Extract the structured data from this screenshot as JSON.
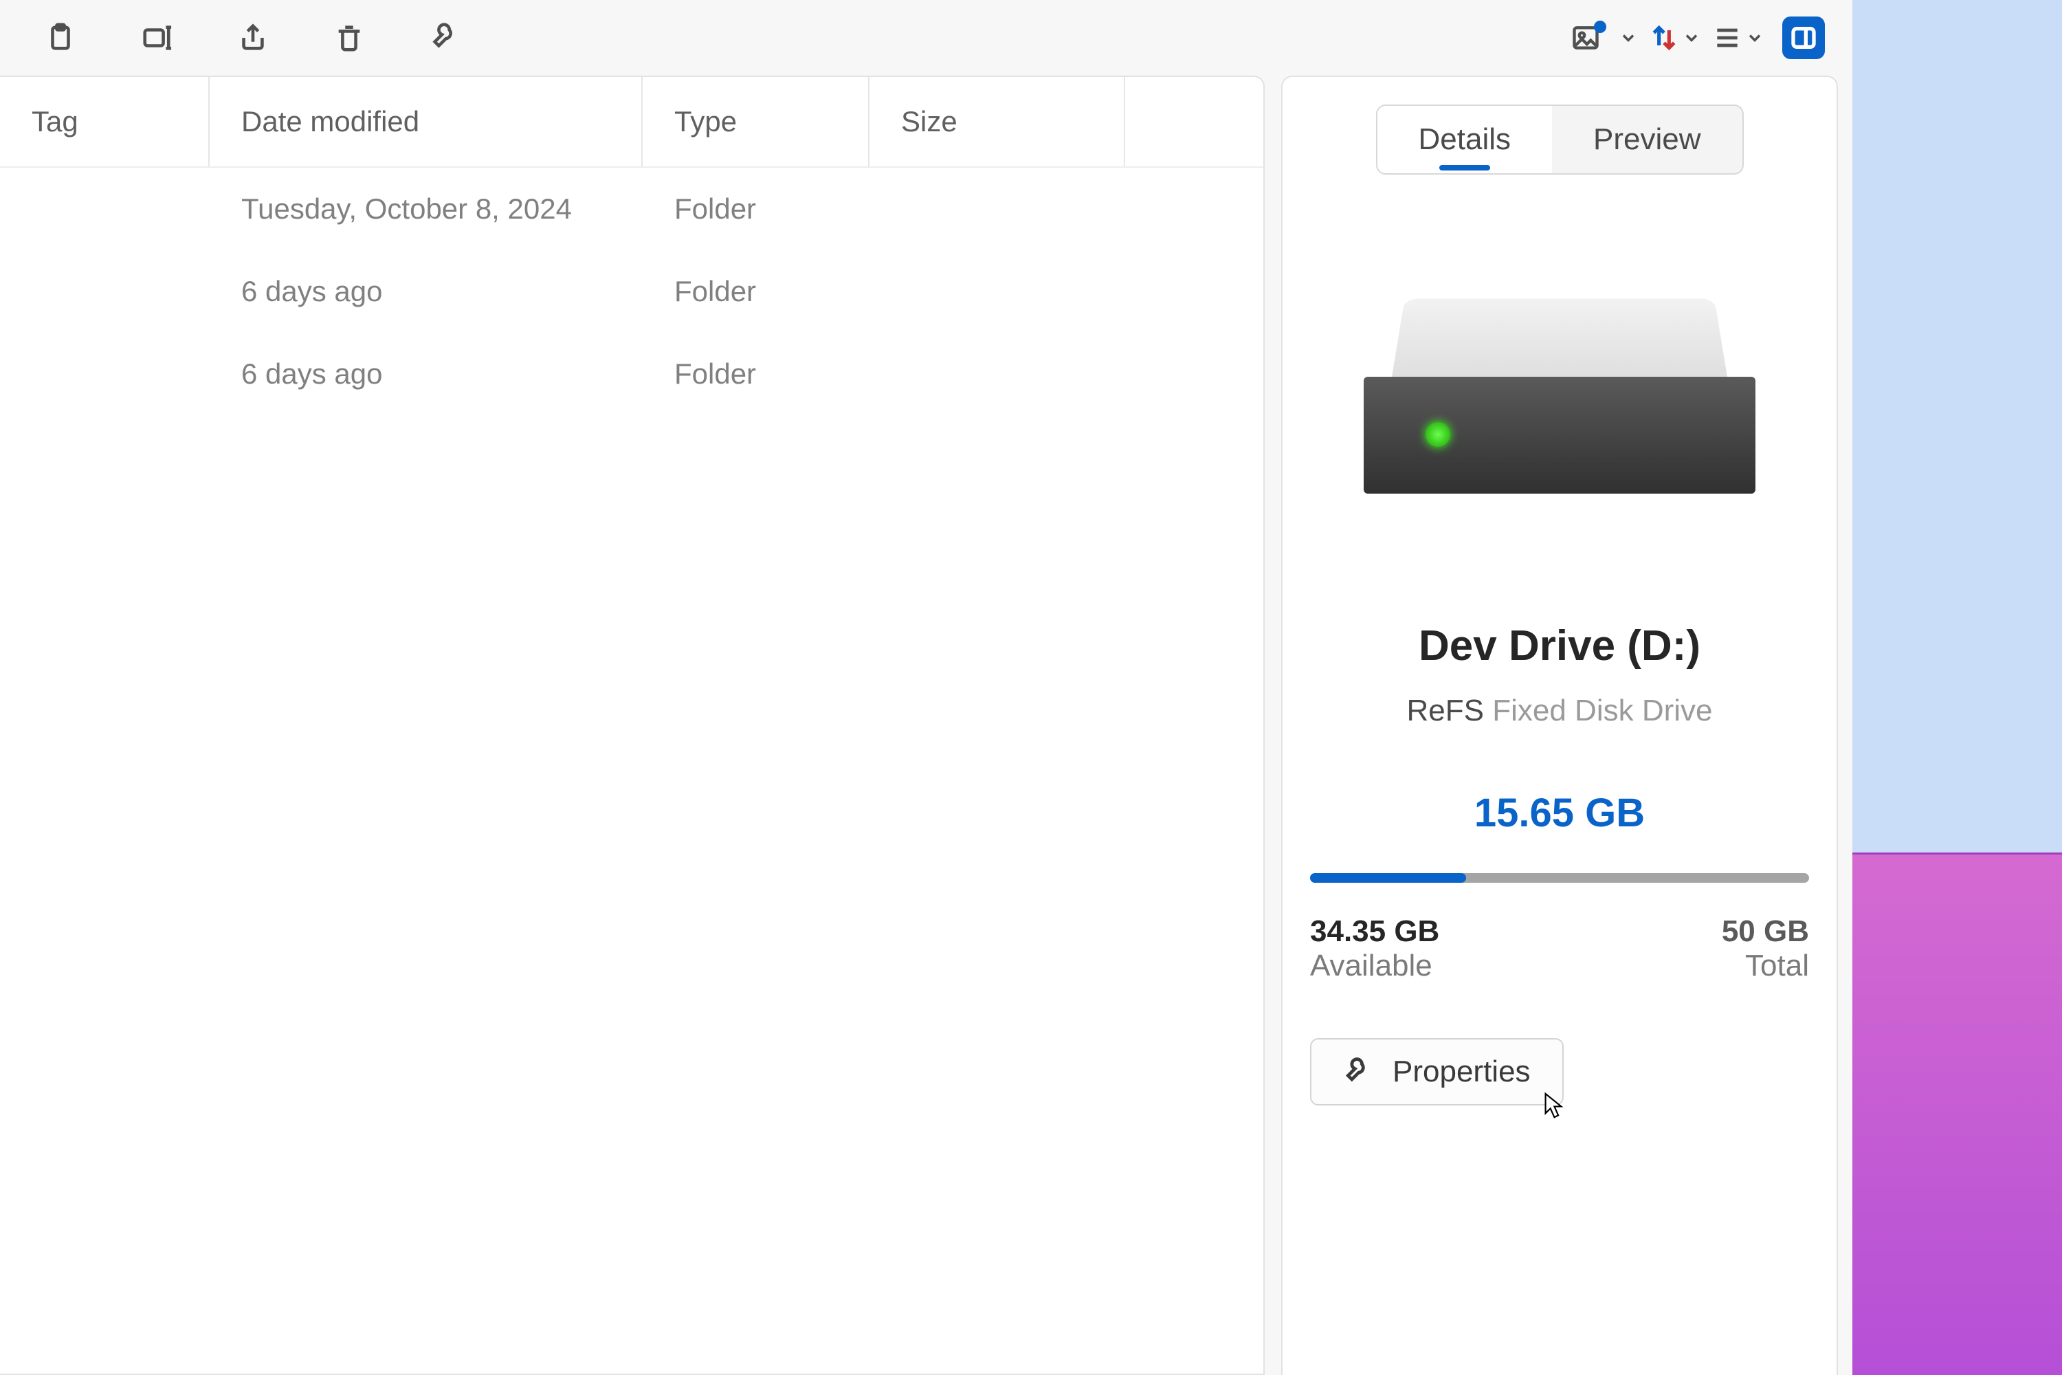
{
  "toolbar": {
    "icons": [
      "paste",
      "rename",
      "share",
      "delete",
      "wrench",
      "picture",
      "sort",
      "layout",
      "panel"
    ]
  },
  "columns": {
    "tag": "Tag",
    "date": "Date modified",
    "type": "Type",
    "size": "Size"
  },
  "rows": [
    {
      "tag": "",
      "date": "Tuesday, October 8, 2024",
      "type": "Folder",
      "size": ""
    },
    {
      "tag": "",
      "date": "6 days ago",
      "type": "Folder",
      "size": ""
    },
    {
      "tag": "",
      "date": "6 days ago",
      "type": "Folder",
      "size": ""
    }
  ],
  "tabs": {
    "details": "Details",
    "preview": "Preview",
    "active": "details"
  },
  "drive": {
    "name": "Dev Drive (D:)",
    "fs": "ReFS",
    "kind": "Fixed Disk Drive",
    "used": "15.65 GB",
    "available": "34.35 GB",
    "available_label": "Available",
    "total": "50 GB",
    "total_label": "Total",
    "used_pct": 31.3
  },
  "properties_label": "Properties"
}
